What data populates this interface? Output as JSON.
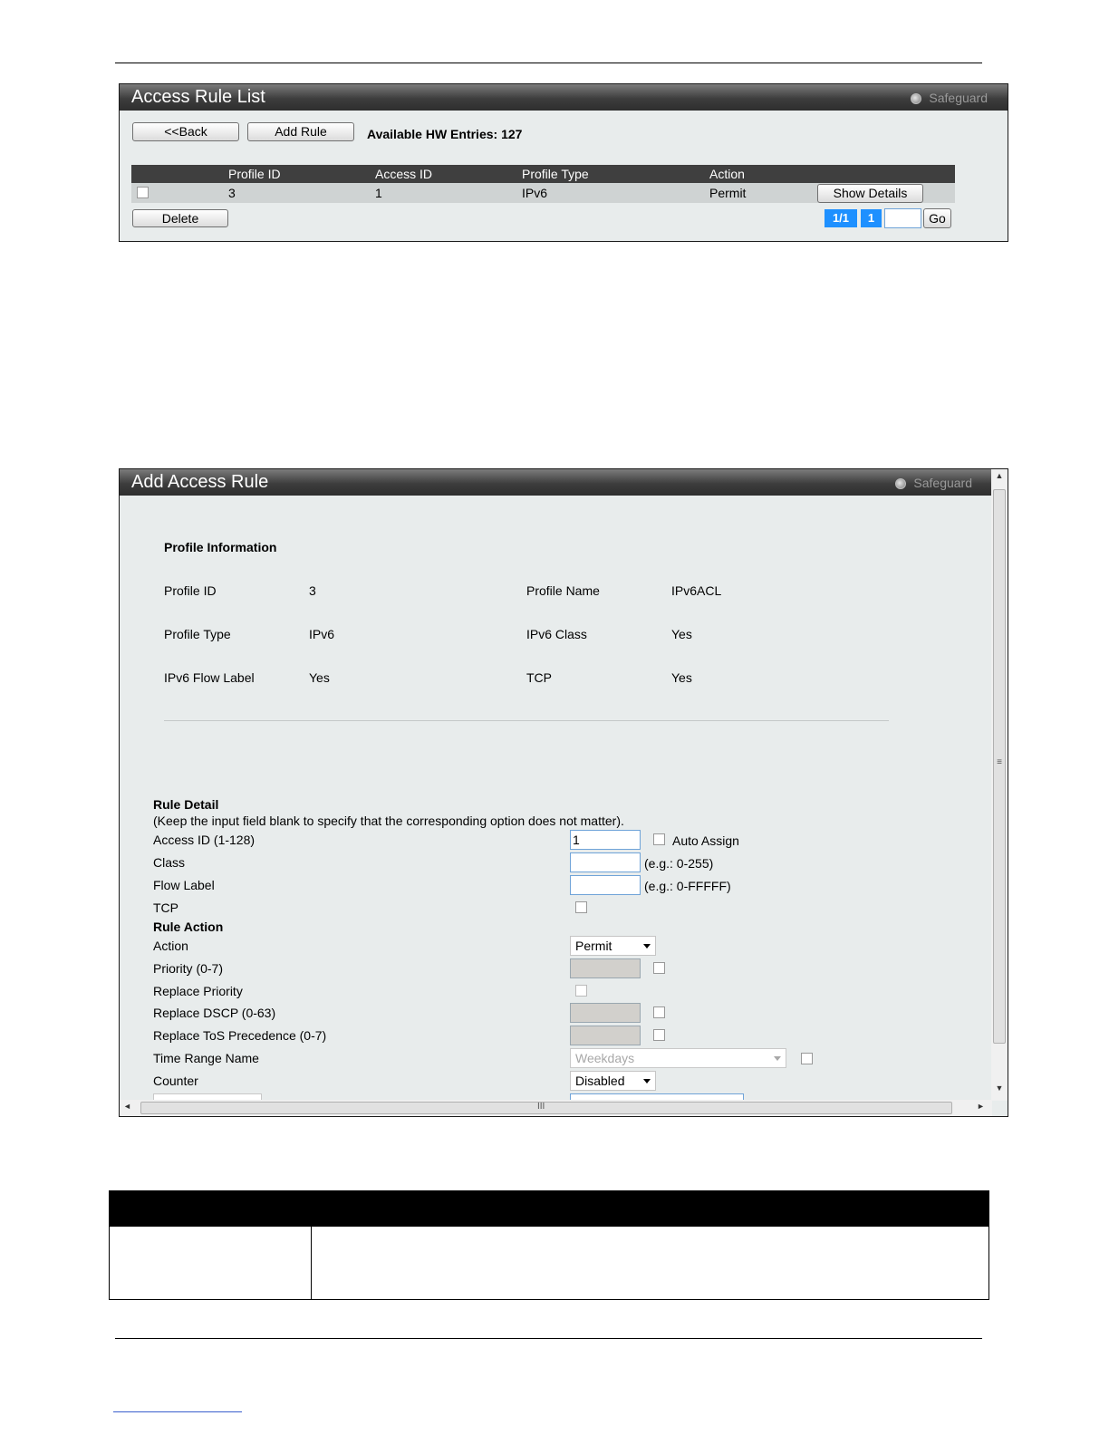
{
  "access_rule_list": {
    "title": "Access Rule List",
    "safeguard": "Safeguard",
    "back_label": "<<Back",
    "add_rule_label": "Add Rule",
    "available_hw_entries": "Available HW Entries: 127",
    "columns": [
      "Profile ID",
      "Access ID",
      "Profile Type",
      "Action"
    ],
    "rows": [
      {
        "profile_id": "3",
        "access_id": "1",
        "profile_type": "IPv6",
        "action": "Permit",
        "show_details_label": "Show Details"
      }
    ],
    "delete_label": "Delete",
    "pagination": {
      "page_of": "1/1",
      "current_page": "1",
      "go_label": "Go",
      "page_input_value": ""
    }
  },
  "add_access_rule": {
    "title": "Add Access Rule",
    "safeguard": "Safeguard",
    "profile_information": {
      "heading": "Profile Information",
      "profile_id_label": "Profile ID",
      "profile_id_value": "3",
      "profile_name_label": "Profile Name",
      "profile_name_value": "IPv6ACL",
      "profile_type_label": "Profile Type",
      "profile_type_value": "IPv6",
      "ipv6_class_label": "IPv6 Class",
      "ipv6_class_value": "Yes",
      "ipv6_flow_label_label": "IPv6 Flow Label",
      "ipv6_flow_label_value": "Yes",
      "tcp_label": "TCP",
      "tcp_value": "Yes"
    },
    "rule_detail": {
      "heading": "Rule Detail",
      "note": "(Keep the input field blank to specify that the corresponding option does not matter).",
      "access_id_label": "Access ID (1-128)",
      "access_id_value": "1",
      "auto_assign_label": "Auto Assign",
      "class_label": "Class",
      "class_hint": "(e.g.: 0-255)",
      "flow_label_label": "Flow Label",
      "flow_label_hint": "(e.g.: 0-FFFFF)",
      "tcp_label": "TCP"
    },
    "rule_action": {
      "heading": "Rule Action",
      "action_label": "Action",
      "action_value": "Permit",
      "priority_label": "Priority  (0-7)",
      "replace_priority_label": "Replace Priority",
      "replace_dscp_label": "Replace DSCP  (0-63)",
      "replace_tos_label": "Replace ToS Precedence  (0-7)",
      "time_range_label": "Time Range Name",
      "time_range_value": "Weekdays",
      "counter_label": "Counter",
      "counter_value": "Disabled"
    },
    "scrollbar": {
      "up": "▲",
      "down": "▼",
      "left": "◄",
      "right": "►",
      "grip_v": "≡",
      "grip_h": "III"
    }
  },
  "colors": {
    "title_bar": "#3d3d3d",
    "panel_bg": "#e8ecec",
    "accent_blue": "#1e90ff",
    "table_header": "#3f3f3f"
  }
}
